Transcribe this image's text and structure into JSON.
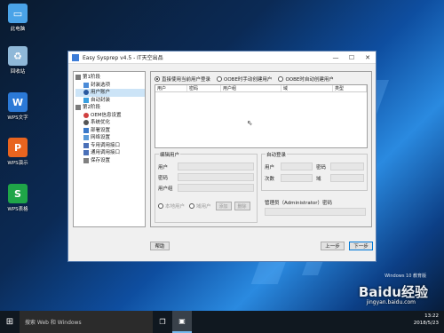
{
  "desktop": {
    "icons": [
      {
        "label": "此电脑",
        "icon": "computer-icon",
        "color": "#4aa3e8"
      },
      {
        "label": "回收站",
        "icon": "recycle-bin-icon",
        "color": "#8fb8d8"
      },
      {
        "label": "WPS文字",
        "icon": "wps-writer-icon",
        "color": "#2b79d6"
      },
      {
        "label": "WPS演示",
        "icon": "wps-presentation-icon",
        "color": "#e8641f"
      },
      {
        "label": "WPS表格",
        "icon": "wps-spreadsheet-icon",
        "color": "#1fa548"
      }
    ]
  },
  "window": {
    "title": "Easy Sysprep v4.5 - IT天空出品",
    "tree": [
      {
        "label": "第1阶段",
        "level": 0,
        "icon": "folder-icon"
      },
      {
        "label": "封装选项",
        "level": 1,
        "icon": "settings-icon"
      },
      {
        "label": "用户账户",
        "level": 1,
        "icon": "user-icon",
        "selected": true
      },
      {
        "label": "自动封装",
        "level": 1,
        "icon": "auto-icon"
      },
      {
        "label": "第2阶段",
        "level": 0,
        "icon": "folder-icon"
      },
      {
        "label": "OEM信息设置",
        "level": 1,
        "icon": "info-icon"
      },
      {
        "label": "系统优化",
        "level": 1,
        "icon": "gear-icon"
      },
      {
        "label": "部署设置",
        "level": 1,
        "icon": "deploy-icon"
      },
      {
        "label": "网络设置",
        "level": 1,
        "icon": "network-icon"
      },
      {
        "label": "专用调用接口",
        "level": 1,
        "icon": "interface-icon"
      },
      {
        "label": "通用调用接口",
        "level": 1,
        "icon": "interface-icon"
      },
      {
        "label": "保存设置",
        "level": 1,
        "icon": "save-icon"
      }
    ],
    "radios": [
      {
        "label": "直接使用当前用户登录",
        "checked": true
      },
      {
        "label": "OOBE时手动创建用户",
        "checked": false
      },
      {
        "label": "OOBE时自动创建用户",
        "checked": false
      }
    ],
    "grid_columns": [
      "用户",
      "密码",
      "用户组",
      "域",
      "类型"
    ],
    "edit_user": {
      "title": "编辑用户",
      "user_label": "用户",
      "password_label": "密码",
      "group_label": "用户组",
      "local_user": "本地用户",
      "domain_user": "域用户",
      "add_label": "添加",
      "delete_label": "删除"
    },
    "auto_login": {
      "title": "自动登录",
      "user_label": "用户",
      "password_label": "密码",
      "count_label": "次数",
      "domain_label": "域"
    },
    "admin_password_label": "管理员（Administrator）密码",
    "help_button": "帮助",
    "prev_button": "上一步",
    "next_button": "下一步"
  },
  "taskbar": {
    "search_placeholder": "搜索 Web 和 Windows",
    "time": "13:22",
    "date": "2018/5/23"
  },
  "overlay": {
    "win_text": "Windows 10 教育版",
    "watermark": "Baidu经验",
    "watermark_sub": "jingyan.baidu.com"
  }
}
